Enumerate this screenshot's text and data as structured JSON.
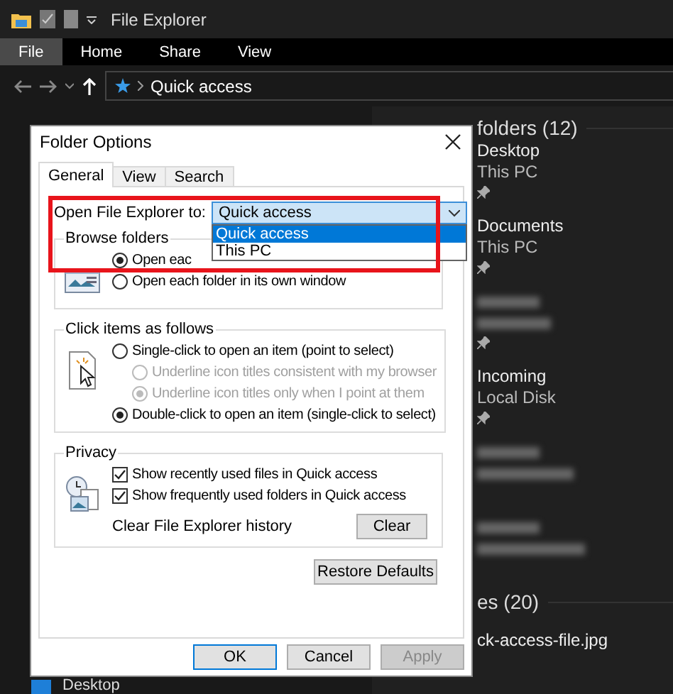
{
  "window": {
    "title": "File Explorer"
  },
  "ribbon_tabs": [
    {
      "label": "File",
      "selected": true
    },
    {
      "label": "Home",
      "selected": false
    },
    {
      "label": "Share",
      "selected": false
    },
    {
      "label": "View",
      "selected": false
    }
  ],
  "address_bar": {
    "path": "Quick access"
  },
  "navigation_pane": {
    "items": [
      {
        "label": "Desktop"
      }
    ]
  },
  "content": {
    "sections": [
      {
        "title": "folders (12)",
        "items": [
          {
            "kind": "folder",
            "name": "Desktop",
            "location": "This PC",
            "pinned": true
          },
          {
            "kind": "folder",
            "name": "Documents",
            "location": "This PC",
            "pinned": true
          },
          {
            "kind": "blurred",
            "pinned": true
          },
          {
            "kind": "folder",
            "name": "Incoming",
            "location": "Local Disk",
            "pinned": true
          },
          {
            "kind": "blurred",
            "pinned": false
          },
          {
            "kind": "blurred",
            "pinned": false
          }
        ]
      },
      {
        "title": "es (20)",
        "items": [
          {
            "kind": "file",
            "name": "ck-access-file.jpg",
            "pinned": false
          }
        ]
      }
    ]
  },
  "dialog": {
    "title": "Folder Options",
    "tabs": [
      {
        "label": "General",
        "selected": true
      },
      {
        "label": "View",
        "selected": false
      },
      {
        "label": "Search",
        "selected": false
      }
    ],
    "open_to": {
      "label": "Open File Explorer to:",
      "value": "Quick access",
      "expanded": true,
      "highlighted": true,
      "options": [
        {
          "label": "Quick access",
          "selected": true
        },
        {
          "label": "This PC",
          "selected": false
        }
      ]
    },
    "groups": [
      {
        "title": "Browse folders",
        "kind": "browse",
        "options": [
          {
            "label": "Open eac",
            "selected": true,
            "disabled": false
          },
          {
            "label": "Open each folder in its own window",
            "selected": false,
            "disabled": false
          }
        ]
      },
      {
        "title": "Click items as follows",
        "kind": "click",
        "options": [
          {
            "label": "Single-click to open an item (point to select)",
            "selected": false,
            "disabled": false,
            "children": [
              {
                "label": "Underline icon titles consistent with my browser",
                "selected": false,
                "disabled": true
              },
              {
                "label": "Underline icon titles only when I point at them",
                "selected": true,
                "disabled": true
              }
            ]
          },
          {
            "label": "Double-click to open an item (single-click to select)",
            "selected": true,
            "disabled": false
          }
        ]
      },
      {
        "title": "Privacy",
        "kind": "privacy",
        "checks": [
          {
            "label": "Show recently used files in Quick access",
            "checked": true
          },
          {
            "label": "Show frequently used folders in Quick access",
            "checked": true
          }
        ],
        "action": {
          "label": "Clear File Explorer history",
          "button": "Clear"
        }
      }
    ],
    "restore_button": "Restore Defaults",
    "buttons": [
      {
        "label": "OK",
        "focused": true,
        "disabled": false
      },
      {
        "label": "Cancel",
        "focused": false,
        "disabled": false
      },
      {
        "label": "Apply",
        "focused": false,
        "disabled": true
      }
    ]
  }
}
